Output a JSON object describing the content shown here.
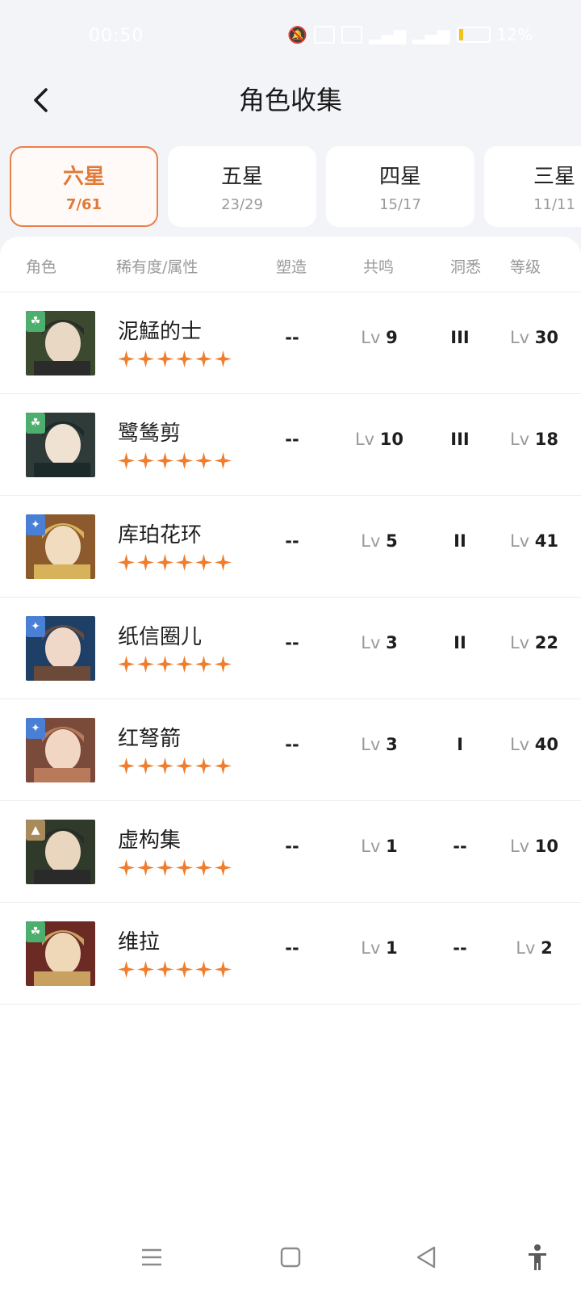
{
  "status_bar": {
    "time": "00:50",
    "battery": "12%",
    "icons": [
      "mute-icon",
      "network-speed-icon",
      "nfc-icon",
      "signal-icon",
      "signal-icon",
      "battery-icon"
    ]
  },
  "header": {
    "title": "角色收集"
  },
  "tabs": [
    {
      "label": "六星",
      "count": "7/61",
      "active": true
    },
    {
      "label": "五星",
      "count": "23/29",
      "active": false
    },
    {
      "label": "四星",
      "count": "15/17",
      "active": false
    },
    {
      "label": "三星",
      "count": "11/11",
      "active": false
    }
  ],
  "columns": {
    "character": "角色",
    "rarity": "稀有度/属性",
    "shaping": "塑造",
    "resonance": "共鸣",
    "insight": "洞悉",
    "level": "等级"
  },
  "lv_prefix": "Lv",
  "characters": [
    {
      "name": "泥鯭的士",
      "stars": 6,
      "element": "leaf-icon",
      "element_color": "#4caf6e",
      "shaping": "--",
      "resonance": "9",
      "insight": "III",
      "level": "30"
    },
    {
      "name": "鹭鸶剪",
      "stars": 6,
      "element": "leaf-icon",
      "element_color": "#4caf6e",
      "shaping": "--",
      "resonance": "10",
      "insight": "III",
      "level": "18"
    },
    {
      "name": "库珀花环",
      "stars": 6,
      "element": "star-spark-icon",
      "element_color": "#4a7fd6",
      "shaping": "--",
      "resonance": "5",
      "insight": "II",
      "level": "41"
    },
    {
      "name": "纸信圈儿",
      "stars": 6,
      "element": "star-spark-icon",
      "element_color": "#4a7fd6",
      "shaping": "--",
      "resonance": "3",
      "insight": "II",
      "level": "22"
    },
    {
      "name": "红弩箭",
      "stars": 6,
      "element": "star-spark-icon",
      "element_color": "#4a7fd6",
      "shaping": "--",
      "resonance": "3",
      "insight": "I",
      "level": "40"
    },
    {
      "name": "虚构集",
      "stars": 6,
      "element": "mountain-icon",
      "element_color": "#a98b5b",
      "shaping": "--",
      "resonance": "1",
      "insight": "--",
      "level": "10"
    },
    {
      "name": "维拉",
      "stars": 6,
      "element": "leaf-icon",
      "element_color": "#4caf6e",
      "shaping": "--",
      "resonance": "1",
      "insight": "--",
      "level": "2"
    }
  ],
  "colors": {
    "accent": "#e8814a",
    "star": "#ef7d2e",
    "background": "#f3f4f8"
  },
  "navbar": {
    "icons": [
      "menu-icon",
      "home-square-icon",
      "back-triangle-icon",
      "accessibility-icon"
    ]
  }
}
